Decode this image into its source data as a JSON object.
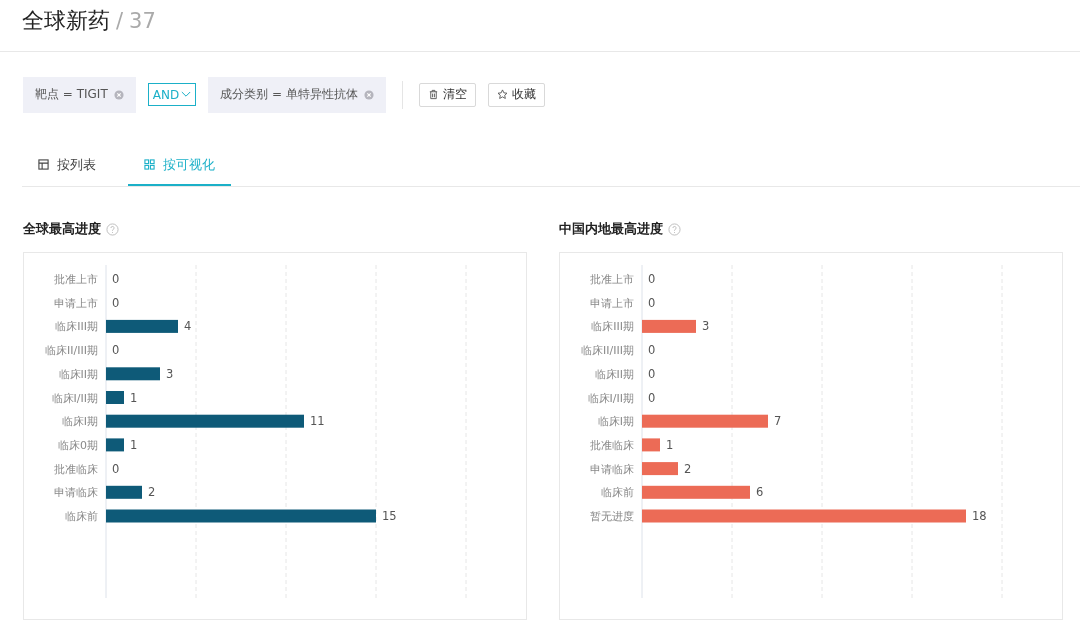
{
  "header": {
    "title": "全球新药",
    "separator": "/",
    "count": "37"
  },
  "filters": [
    {
      "kind": "chip",
      "text": "靶点 = TIGIT"
    },
    {
      "kind": "operator",
      "text": "AND"
    },
    {
      "kind": "chip",
      "text": "成分类别 = 单特异性抗体"
    }
  ],
  "actions": [
    {
      "kind": "clear",
      "label": "清空"
    },
    {
      "kind": "save",
      "label": "收藏"
    }
  ],
  "tabs": [
    {
      "kind": "table",
      "label": "按列表",
      "selected": false
    },
    {
      "kind": "grid",
      "label": "按可视化",
      "selected": true
    }
  ],
  "charts": [
    {
      "title": "全球最高进度",
      "chart_data": {
        "type": "bar",
        "orientation": "horizontal",
        "categories": [
          "批准上市",
          "申请上市",
          "临床III期",
          "临床II/III期",
          "临床II期",
          "临床I/II期",
          "临床I期",
          "临床0期",
          "批准临床",
          "申请临床",
          "临床前"
        ],
        "series": [
          {
            "color": "#0e5a78",
            "values": [
              0,
              0,
              4,
              0,
              3,
              1,
              11,
              1,
              0,
              2,
              15
            ]
          }
        ],
        "xlim": [
          0,
          20
        ],
        "data_labels": true
      }
    },
    {
      "title": "中国内地最高进度",
      "chart_data": {
        "type": "bar",
        "orientation": "horizontal",
        "categories": [
          "批准上市",
          "申请上市",
          "临床III期",
          "临床II/III期",
          "临床II期",
          "临床I/II期",
          "临床I期",
          "批准临床",
          "申请临床",
          "临床前",
          "暂无进度"
        ],
        "series": [
          {
            "color": "#ec6b56",
            "values": [
              0,
              0,
              3,
              0,
              0,
              0,
              7,
              1,
              2,
              6,
              18
            ]
          }
        ],
        "xlim": [
          0,
          20
        ],
        "data_labels": true
      }
    }
  ]
}
